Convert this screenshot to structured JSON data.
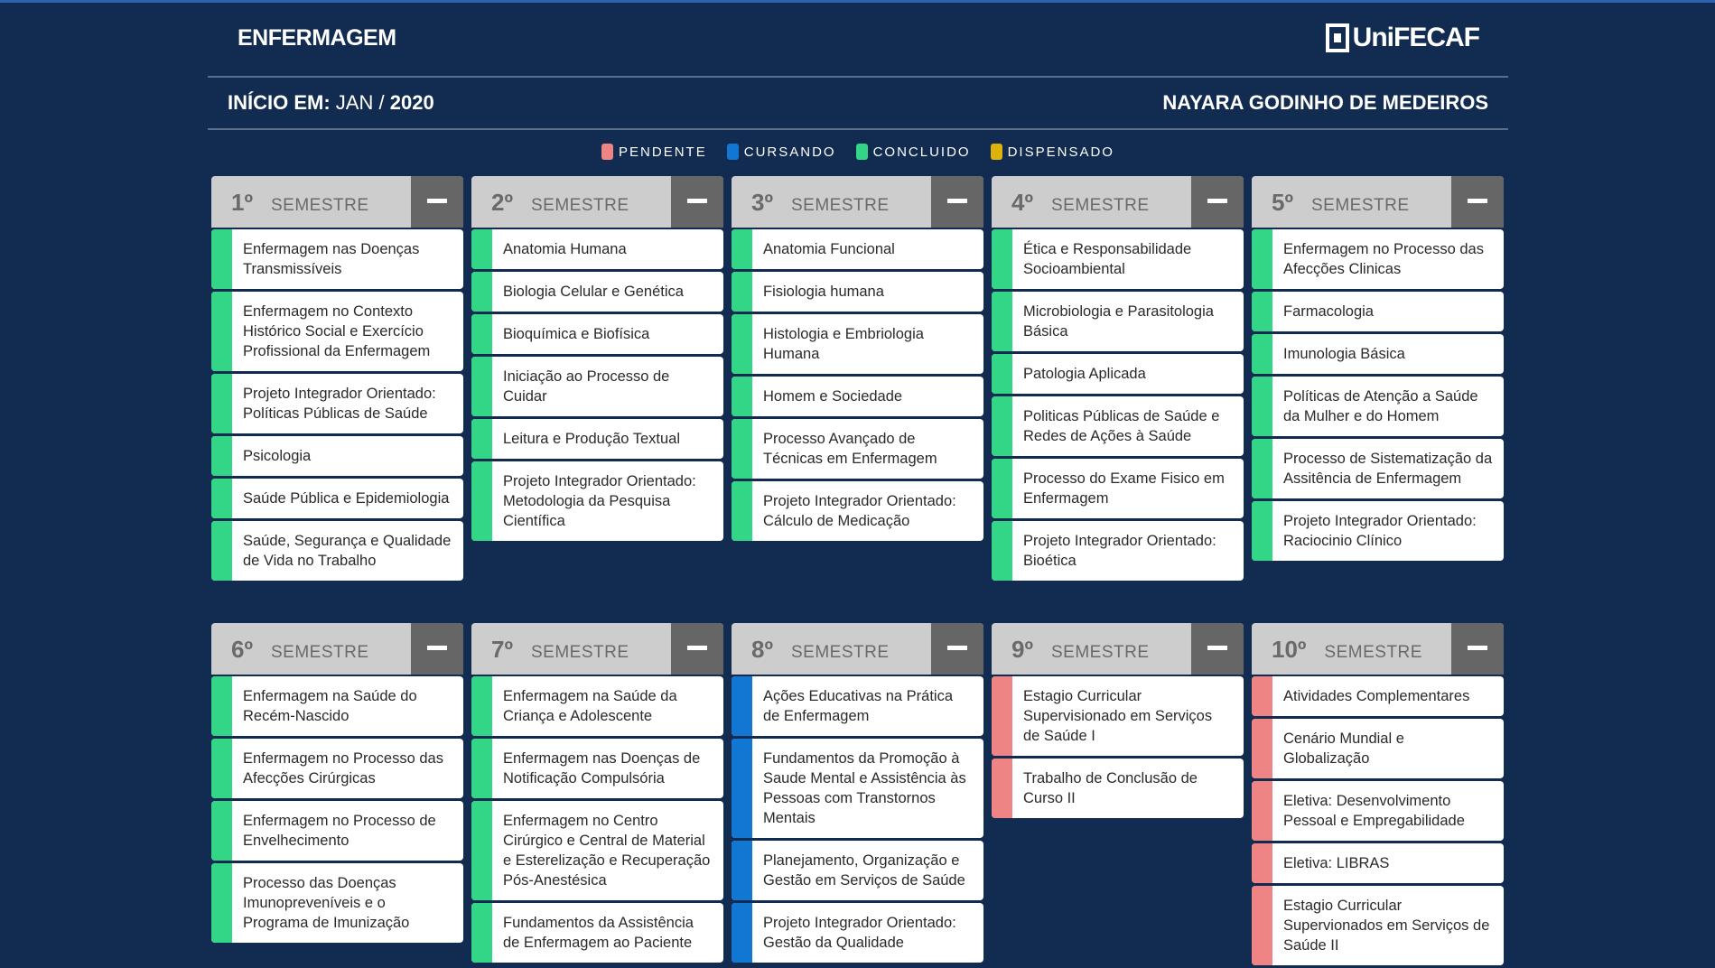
{
  "header": {
    "course": "ENFERMAGEM",
    "logo": "UniFECAF",
    "start_label": "INÍCIO EM:",
    "start_month": "JAN",
    "start_sep": "/",
    "start_year": "2020",
    "student": "NAYARA GODINHO DE MEDEIROS"
  },
  "legend": [
    {
      "label": "PENDENTE",
      "color": "#ee8483"
    },
    {
      "label": "CURSANDO",
      "color": "#1276d3"
    },
    {
      "label": "CONCLUIDO",
      "color": "#33d687"
    },
    {
      "label": "DISPENSADO",
      "color": "#dcb20b"
    }
  ],
  "semester_label": "SEMESTRE",
  "semesters": [
    {
      "num": "1º",
      "status": "CONCLUIDO",
      "items": [
        "Enfermagem nas Doenças Transmissíveis",
        "Enfermagem no Contexto Histórico Social e Exercício Profissional da Enfermagem",
        "Projeto Integrador Orientado: Políticas Públicas de Saúde",
        "Psicologia",
        "Saúde Pública e Epidemiologia",
        "Saúde, Segurança e Qualidade de Vida no Trabalho"
      ]
    },
    {
      "num": "2º",
      "status": "CONCLUIDO",
      "items": [
        "Anatomia Humana",
        "Biologia Celular e Genética",
        "Bioquímica e Biofísica",
        "Iniciação ao Processo de Cuidar",
        "Leitura e Produção Textual",
        "Projeto Integrador Orientado: Metodologia da Pesquisa Científica"
      ]
    },
    {
      "num": "3º",
      "status": "CONCLUIDO",
      "items": [
        "Anatomia Funcional",
        "Fisiologia humana",
        "Histologia e Embriologia Humana",
        "Homem e Sociedade",
        "Processo Avançado de Técnicas em Enfermagem",
        "Projeto Integrador Orientado: Cálculo de Medicação"
      ]
    },
    {
      "num": "4º",
      "status": "CONCLUIDO",
      "items": [
        "Ética e Responsabilidade Socioambiental",
        "Microbiologia e Parasitologia Básica",
        "Patologia Aplicada",
        "Politicas Públicas de Saúde e Redes de Ações à Saúde",
        "Processo do Exame Fisico em Enfermagem",
        "Projeto Integrador Orientado: Bioética"
      ]
    },
    {
      "num": "5º",
      "status": "CONCLUIDO",
      "items": [
        "Enfermagem no Processo das Afecções Clinicas",
        "Farmacologia",
        "Imunologia Básica",
        "Políticas de Atenção a Saúde da Mulher e do Homem",
        "Processo de Sistematização da Assitência de Enfermagem",
        "Projeto Integrador Orientado: Raciocinio Clínico"
      ]
    },
    {
      "num": "6º",
      "status": "CONCLUIDO",
      "items": [
        "Enfermagem na Saúde do Recém-Nascido",
        "Enfermagem no Processo das Afecções Cirúrgicas",
        "Enfermagem no Processo de Envelhecimento",
        "Processo das Doenças Imunopreveníveis e o Programa de Imunização"
      ]
    },
    {
      "num": "7º",
      "status": "CONCLUIDO",
      "items": [
        "Enfermagem na Saúde da Criança e Adolescente",
        "Enfermagem nas Doenças de Notificação Compulsória",
        "Enfermagem no Centro Cirúrgico e Central de Material e Esterelização e Recuperação Pós-Anestésica",
        "Fundamentos da Assistência de Enfermagem ao Paciente"
      ]
    },
    {
      "num": "8º",
      "status": "CURSANDO",
      "items": [
        "Ações Educativas na Prática de Enfermagem",
        "Fundamentos da Promoção à Saude Mental e Assistência às Pessoas com Transtornos Mentais",
        "Planejamento, Organização e Gestão em Serviços de Saúde",
        "Projeto Integrador Orientado: Gestão da Qualidade"
      ]
    },
    {
      "num": "9º",
      "status": "PENDENTE",
      "items": [
        "Estagio Curricular Supervisionado em Serviços de Saúde I",
        "Trabalho de Conclusão de Curso II"
      ]
    },
    {
      "num": "10º",
      "status": "PENDENTE",
      "items": [
        "Atividades Complementares",
        "Cenário Mundial e Globalização",
        "Eletiva: Desenvolvimento Pessoal e Empregabilidade",
        "Eletiva: LIBRAS",
        "Estagio Curricular Supervionados em Serviços de Saúde II"
      ]
    }
  ]
}
